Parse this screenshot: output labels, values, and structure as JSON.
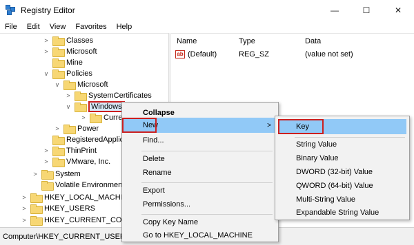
{
  "window": {
    "title": "Registry Editor",
    "controls": {
      "minimize": "—",
      "maximize": "☐",
      "close": "✕"
    }
  },
  "menubar": [
    "File",
    "Edit",
    "View",
    "Favorites",
    "Help"
  ],
  "tree": [
    {
      "label": "Classes",
      "expander": ">"
    },
    {
      "label": "Microsoft",
      "expander": ">"
    },
    {
      "label": "Mine",
      "expander": ""
    },
    {
      "label": "Policies",
      "expander": "v"
    },
    {
      "label": "Microsoft",
      "expander": "v"
    },
    {
      "label": "SystemCertificates",
      "expander": ">"
    },
    {
      "label": "Windows",
      "expander": "v"
    },
    {
      "label": "Curren",
      "expander": ">"
    },
    {
      "label": "Power",
      "expander": ">"
    },
    {
      "label": "RegisteredApplic",
      "expander": ""
    },
    {
      "label": "ThinPrint",
      "expander": ">"
    },
    {
      "label": "VMware, Inc.",
      "expander": ">"
    },
    {
      "label": "System",
      "expander": ">"
    },
    {
      "label": "Volatile Environment",
      "expander": ""
    },
    {
      "label": "HKEY_LOCAL_MACHINE",
      "expander": ">"
    },
    {
      "label": "HKEY_USERS",
      "expander": ">"
    },
    {
      "label": "HKEY_CURRENT_CONFIG",
      "expander": ">"
    }
  ],
  "values_pane": {
    "columns": {
      "name": "Name",
      "type": "Type",
      "data": "Data"
    },
    "rows": [
      {
        "icon": "ab",
        "name": "(Default)",
        "type": "REG_SZ",
        "data": "(value not set)"
      }
    ]
  },
  "statusbar": {
    "path": "Computer\\HKEY_CURRENT_USER\\S"
  },
  "context_menu": {
    "items": [
      "Collapse",
      "New",
      "Find...",
      "Delete",
      "Rename",
      "Export",
      "Permissions...",
      "Copy Key Name",
      "Go to HKEY_LOCAL_MACHINE"
    ],
    "submenu_arrow": ">"
  },
  "submenu_new": {
    "items": [
      "Key",
      "String Value",
      "Binary Value",
      "DWORD (32-bit) Value",
      "QWORD (64-bit) Value",
      "Multi-String Value",
      "Expandable String Value"
    ]
  },
  "colors": {
    "highlight": "#91c9f7",
    "annotation": "#cc1f1f",
    "folder": "#f7d774"
  }
}
